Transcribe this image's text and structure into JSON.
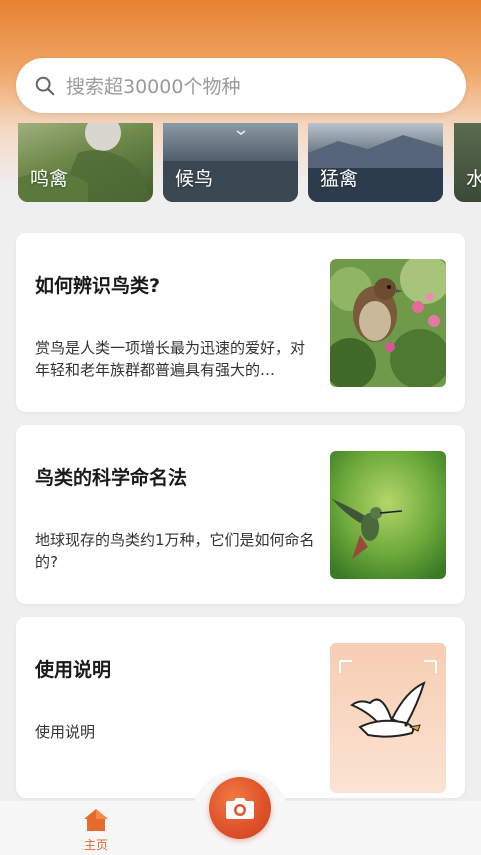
{
  "search": {
    "placeholder": "搜索超30000个物种"
  },
  "categories": [
    {
      "label": "鸣禽"
    },
    {
      "label": "候鸟"
    },
    {
      "label": "猛禽"
    },
    {
      "label": "水"
    }
  ],
  "cards": [
    {
      "title": "如何辨识鸟类?",
      "desc": "赏鸟是人类一项增长最为迅速的爱好，对年轻和老年族群都普遍具有强大的…"
    },
    {
      "title": "鸟类的科学命名法",
      "desc": "地球现存的鸟类约1万种，它们是如何命名的?"
    },
    {
      "title": "使用说明",
      "desc": "使用说明"
    }
  ],
  "nav": {
    "home_label": "主页"
  },
  "colors": {
    "accent": "#e3692a",
    "header_top": "#e5832f"
  },
  "icons": {
    "search": "search-icon",
    "home": "home-icon",
    "camera": "camera-icon"
  }
}
